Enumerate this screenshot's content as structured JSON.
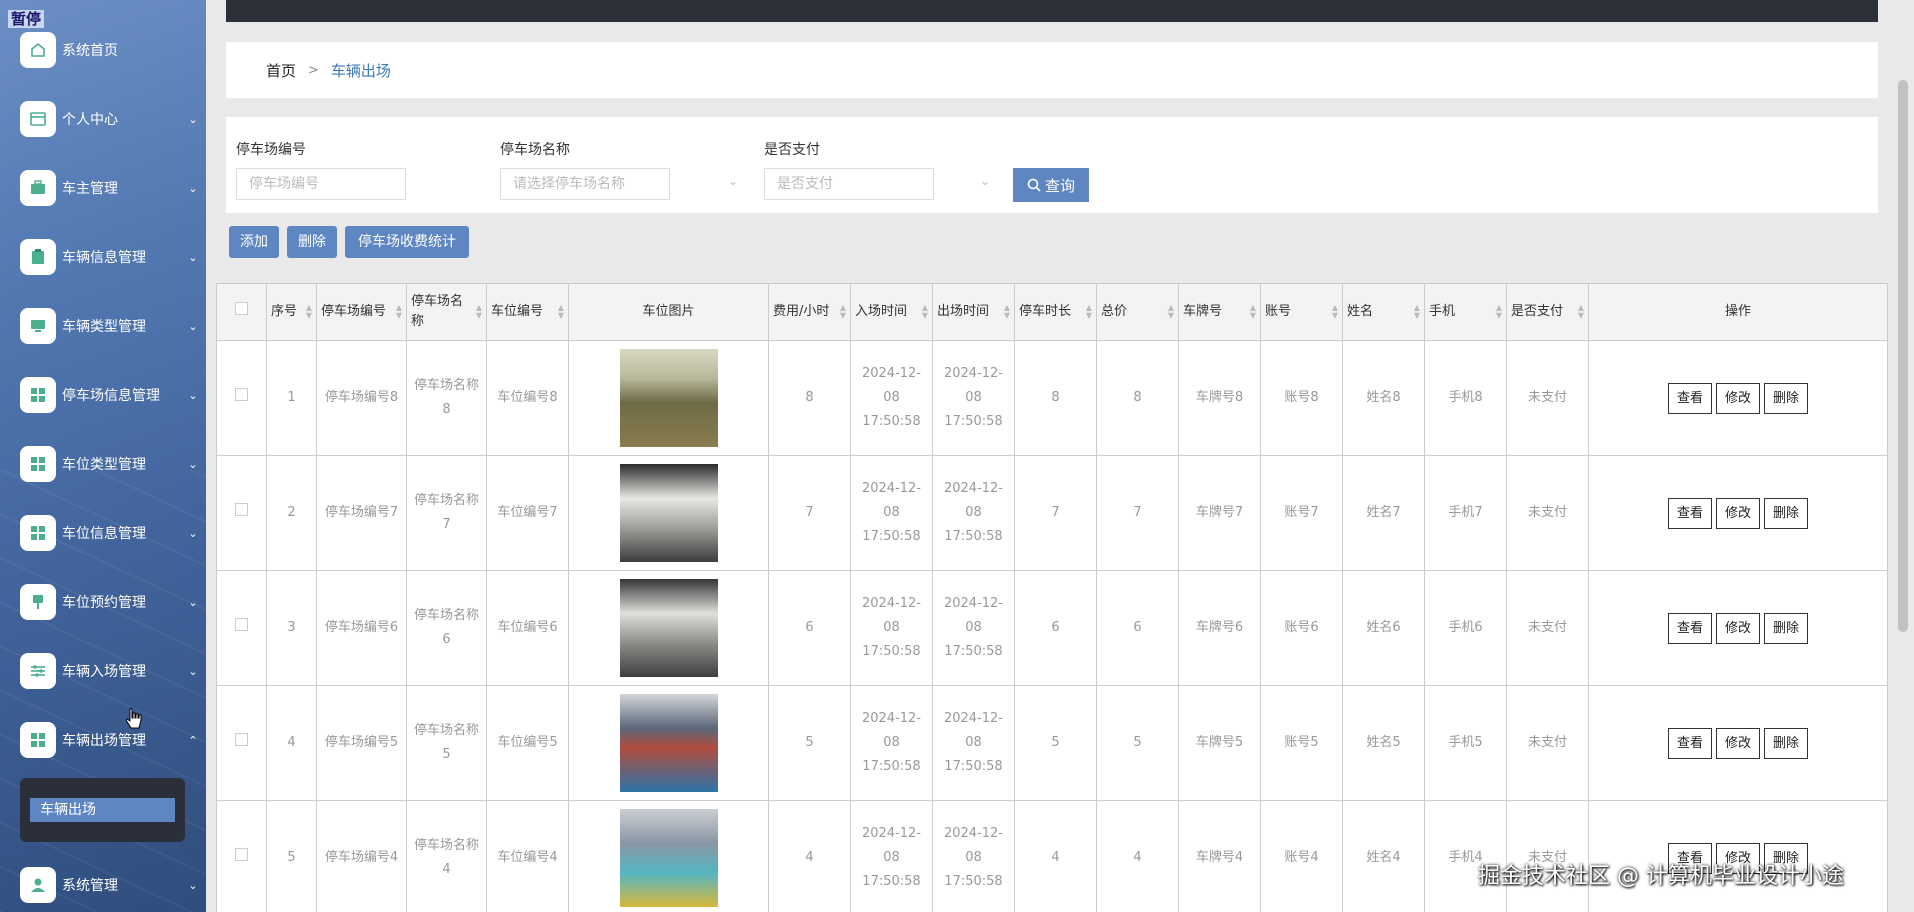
{
  "sidebar": {
    "tag": "暂停",
    "items": [
      {
        "label": "系统首页",
        "icon": "home-icon",
        "chevron": ""
      },
      {
        "label": "个人中心",
        "icon": "card-icon",
        "chevron": "⌄"
      },
      {
        "label": "车主管理",
        "icon": "briefcase-icon",
        "chevron": "⌄"
      },
      {
        "label": "车辆信息管理",
        "icon": "clipboard-icon",
        "chevron": "⌄"
      },
      {
        "label": "车辆类型管理",
        "icon": "monitor-icon",
        "chevron": "⌄"
      },
      {
        "label": "停车场信息管理",
        "icon": "grid-icon",
        "chevron": "⌄"
      },
      {
        "label": "车位类型管理",
        "icon": "grid-icon",
        "chevron": "⌄"
      },
      {
        "label": "车位信息管理",
        "icon": "grid-icon",
        "chevron": "⌄"
      },
      {
        "label": "车位预约管理",
        "icon": "pin-icon",
        "chevron": "⌄"
      },
      {
        "label": "车辆入场管理",
        "icon": "sliders-icon",
        "chevron": "⌄"
      },
      {
        "label": "车辆出场管理",
        "icon": "grid-icon",
        "chevron": "⌃"
      },
      {
        "label": "系统管理",
        "icon": "user-icon",
        "chevron": "⌄"
      }
    ],
    "submenu_item": "车辆出场"
  },
  "breadcrumb": {
    "home": "首页",
    "separator": ">",
    "current": "车辆出场"
  },
  "filters": {
    "lot_no_label": "停车场编号",
    "lot_no_placeholder": "停车场编号",
    "lot_name_label": "停车场名称",
    "lot_name_placeholder": "请选择停车场名称",
    "paid_label": "是否支付",
    "paid_placeholder": "是否支付",
    "search_label": "查询"
  },
  "actions": {
    "add": "添加",
    "delete": "删除",
    "stats": "停车场收费统计"
  },
  "table": {
    "headers": [
      "序号",
      "停车场编号",
      "停车场名称",
      "车位编号",
      "车位图片",
      "费用/小时",
      "入场时间",
      "出场时间",
      "停车时长",
      "总价",
      "车牌号",
      "账号",
      "姓名",
      "手机",
      "是否支付",
      "操作"
    ],
    "op_labels": {
      "view": "查看",
      "edit": "修改",
      "delete": "删除"
    },
    "rows": [
      {
        "idx": "1",
        "lot_no": "停车场编号8",
        "lot_name": "停车场名称8",
        "space_no": "车位编号8",
        "fee": "8",
        "entry": "2024-12-08 17:50:58",
        "exit": "2024-12-08 17:50:58",
        "duration": "8",
        "total": "8",
        "plate": "车牌号8",
        "account": "账号8",
        "name": "姓名8",
        "phone": "手机8",
        "paid": "未支付"
      },
      {
        "idx": "2",
        "lot_no": "停车场编号7",
        "lot_name": "停车场名称7",
        "space_no": "车位编号7",
        "fee": "7",
        "entry": "2024-12-08 17:50:58",
        "exit": "2024-12-08 17:50:58",
        "duration": "7",
        "total": "7",
        "plate": "车牌号7",
        "account": "账号7",
        "name": "姓名7",
        "phone": "手机7",
        "paid": "未支付"
      },
      {
        "idx": "3",
        "lot_no": "停车场编号6",
        "lot_name": "停车场名称6",
        "space_no": "车位编号6",
        "fee": "6",
        "entry": "2024-12-08 17:50:58",
        "exit": "2024-12-08 17:50:58",
        "duration": "6",
        "total": "6",
        "plate": "车牌号6",
        "account": "账号6",
        "name": "姓名6",
        "phone": "手机6",
        "paid": "未支付"
      },
      {
        "idx": "4",
        "lot_no": "停车场编号5",
        "lot_name": "停车场名称5",
        "space_no": "车位编号5",
        "fee": "5",
        "entry": "2024-12-08 17:50:58",
        "exit": "2024-12-08 17:50:58",
        "duration": "5",
        "total": "5",
        "plate": "车牌号5",
        "account": "账号5",
        "name": "姓名5",
        "phone": "手机5",
        "paid": "未支付"
      },
      {
        "idx": "5",
        "lot_no": "停车场编号4",
        "lot_name": "停车场名称4",
        "space_no": "车位编号4",
        "fee": "4",
        "entry": "2024-12-08 17:50:58",
        "exit": "2024-12-08 17:50:58",
        "duration": "4",
        "total": "4",
        "plate": "车牌号4",
        "account": "账号4",
        "name": "姓名4",
        "phone": "手机4",
        "paid": "未支付"
      }
    ]
  },
  "watermark": "掘金技术社区 @ 计算机毕业设计小途",
  "colors": {
    "accent": "#5e86c3",
    "topbar": "#2c3039",
    "submenu_bg": "#2b2f3a"
  }
}
